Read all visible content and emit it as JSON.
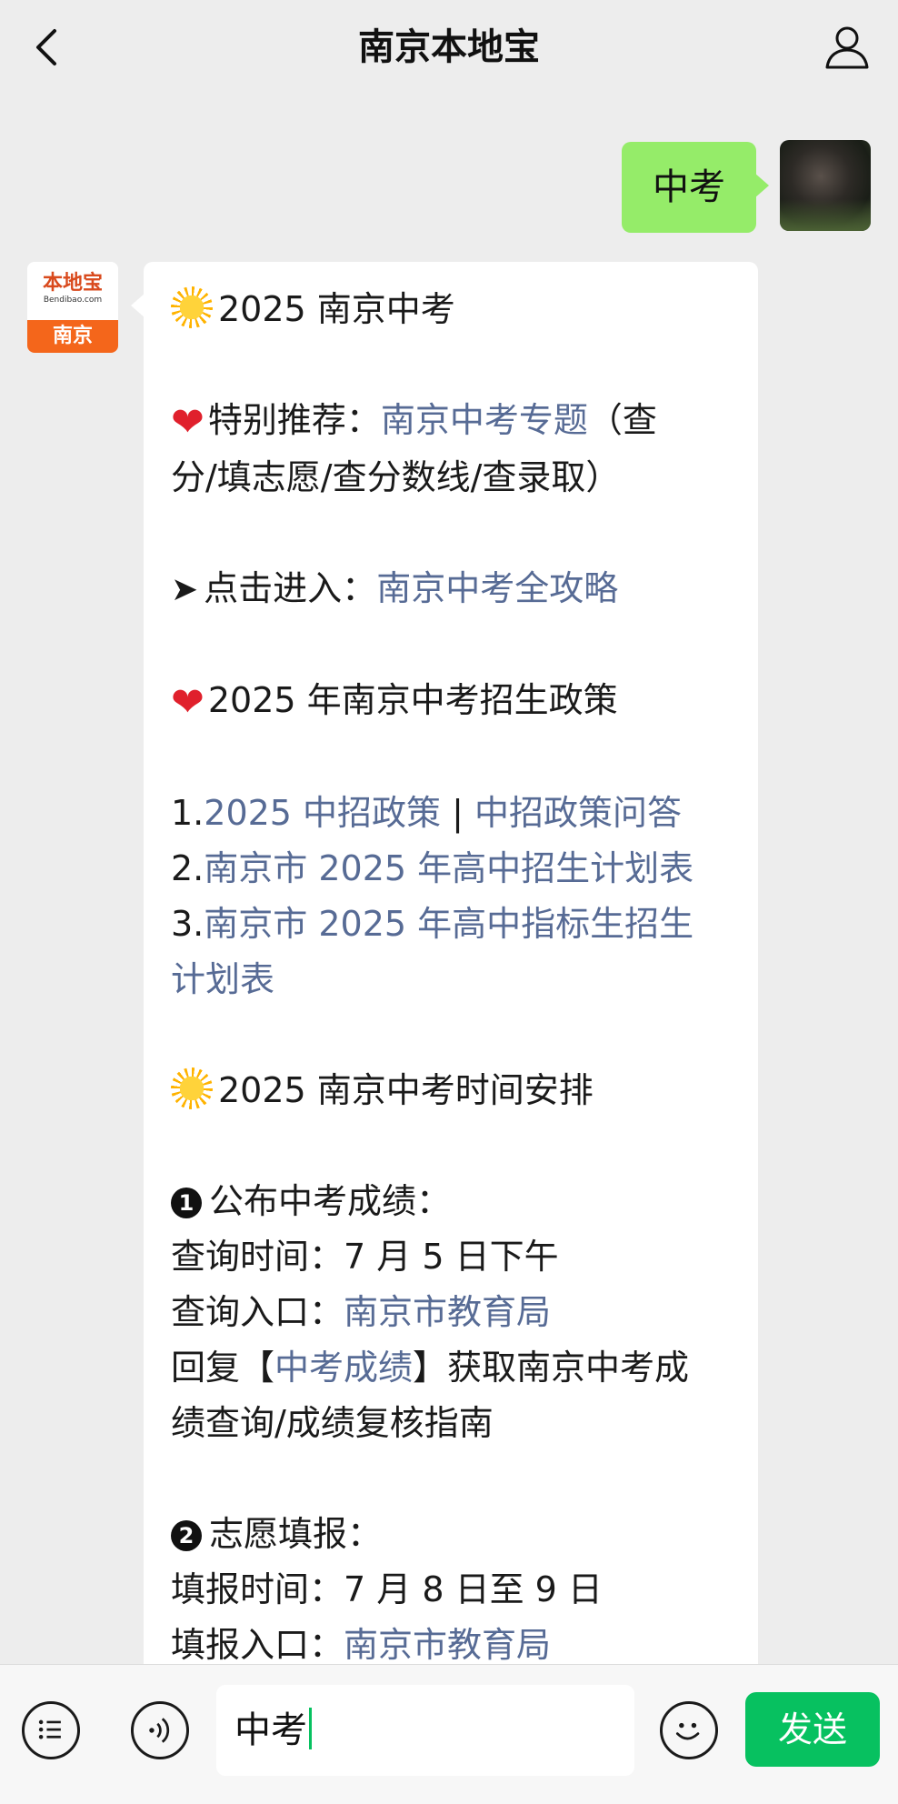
{
  "header": {
    "title": "南京本地宝"
  },
  "user_message": {
    "text": "中考"
  },
  "bot_avatar": {
    "brand": "本地宝",
    "brand_en": "Bendibao.com",
    "city": "南京"
  },
  "bot_message": {
    "line1": "2025 南京中考",
    "rec_label": "特别推荐：",
    "rec_link": "南京中考专题",
    "rec_suffix_1": "（查",
    "rec_suffix_2": "分/填志愿/查分数线/查录取）",
    "enter_label": "点击进入：",
    "enter_link": "南京中考全攻略",
    "policy_title": "2025 年南京中考招生政策",
    "item1_prefix": "1.",
    "item1_link_a": "2025 中招政策",
    "item1_sep": " | ",
    "item1_link_b": "中招政策问答",
    "item2_prefix": "2.",
    "item2_link": "南京市 2025 年高中招生计划表",
    "item3_prefix": "3.",
    "item3_link_1": "南京市 2025 年高中指标生招生",
    "item3_link_2": "计划表",
    "schedule_title": "2025 南京中考时间安排",
    "step1_num": "1",
    "step1_title": "公布中考成绩：",
    "step1_time": "查询时间：7 月 5 日下午",
    "step1_entry_label": "查询入口：",
    "step1_entry_link": "南京市教育局",
    "step1_reply_a": "回复【",
    "step1_reply_link": "中考成绩",
    "step1_reply_b": "】获取南京中考成",
    "step1_reply_c": "绩查询/成绩复核指南",
    "step2_num": "2",
    "step2_title": "志愿填报：",
    "step2_time": "填报时间：7 月 8 日至 9 日",
    "step2_entry_label": "填报入口：",
    "step2_entry_link": "南京市教育局"
  },
  "input_bar": {
    "value": "中考",
    "send_label": "发送"
  },
  "icons": [
    "back-icon",
    "profile-icon",
    "menu-list-icon",
    "voice-icon",
    "emoji-icon"
  ]
}
